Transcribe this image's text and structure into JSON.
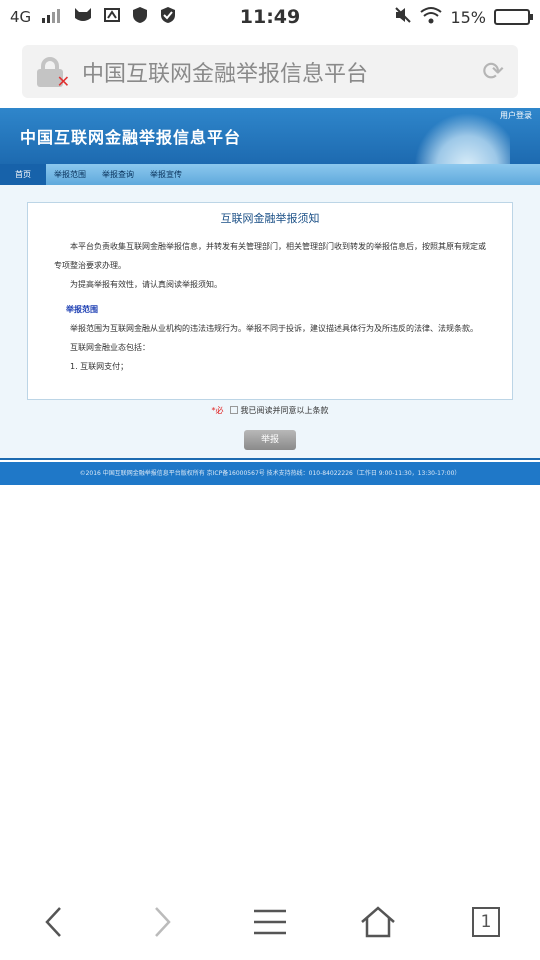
{
  "status_bar": {
    "network": "4G",
    "time": "11:49",
    "battery_percent": "15%",
    "icons": [
      "signal-icon",
      "cat-icon",
      "screenshot-icon",
      "shield-icon",
      "shield-check-icon",
      "mute-icon",
      "wifi-icon",
      "battery-icon"
    ]
  },
  "address_bar": {
    "title": "中国互联网金融举报信息平台",
    "icons": [
      "insecure-lock-icon",
      "reload-icon"
    ]
  },
  "site": {
    "title": "中国互联网金融举报信息平台",
    "login": "用户登录",
    "nav": [
      "首页",
      "举报范围",
      "举报查询",
      "举报宣传"
    ]
  },
  "notice": {
    "title": "互联网金融举报须知",
    "para1": "本平台负责收集互联网金融举报信息，并转发有关管理部门，相关管理部门收到转发的举报信息后，按照其原有规定或专项整治要求办理。",
    "para2": "为提高举报有效性，请认真阅读举报须知。",
    "section_title": "举报范围",
    "para3": "举报范围为互联网金融从业机构的违法违规行为。举报不同于投诉，建议描述具体行为及所违反的法律、法规条款。",
    "para4": "互联网金融业态包括：",
    "para5": "1. 互联网支付；"
  },
  "agree": {
    "required_mark": "*必",
    "text": "我已阅读并同意以上条款"
  },
  "submit_label": "举报",
  "footer_text": "©2016 中国互联网金融举报信息平台版权所有 京ICP备16000567号 技术支持热线：010-84022226（工作日 9:00-11:30，13:30-17:00）",
  "bottom_nav": {
    "tab_count": "1",
    "icons": [
      "back-icon",
      "forward-icon",
      "menu-icon",
      "home-icon",
      "tabs-icon"
    ]
  }
}
